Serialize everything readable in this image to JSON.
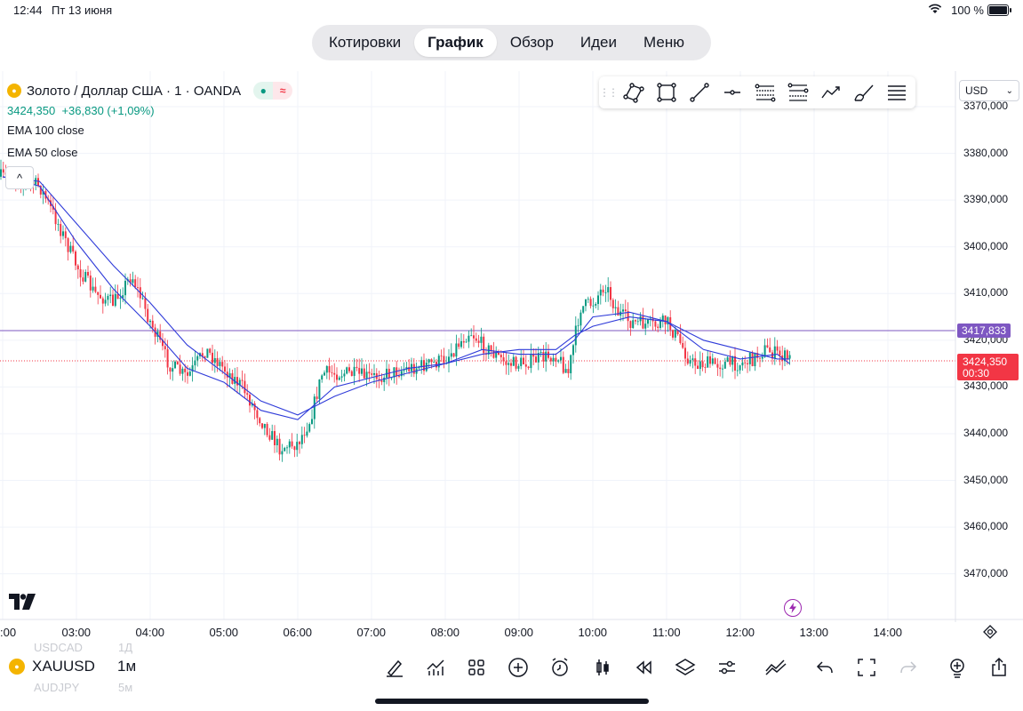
{
  "status_bar": {
    "time": "12:44",
    "date": "Пт 13 июня",
    "battery": "100 %"
  },
  "tabs": [
    {
      "label": "Котировки",
      "active": false
    },
    {
      "label": "График",
      "active": true
    },
    {
      "label": "Обзор",
      "active": false
    },
    {
      "label": "Идеи",
      "active": false
    },
    {
      "label": "Меню",
      "active": false
    }
  ],
  "legend": {
    "symbol_title": "Золото / Доллар США · 1 · OANDA",
    "last_price": "3424,350",
    "change": "+36,830 (+1,09%)",
    "indicators": [
      "EMA 100 close",
      "EMA 50 close"
    ],
    "collapse_glyph": "^"
  },
  "drawing_tools": [
    "pattern-icon",
    "rectangle-icon",
    "trend-line-icon",
    "horizontal-ray-icon",
    "fib-retracement-icon",
    "pitchfork-icon",
    "path-icon",
    "brush-icon",
    "more-tools-icon"
  ],
  "currency": {
    "selected": "USD"
  },
  "y_axis": {
    "ticks": [
      "3370,000",
      "3380,000",
      "3390,000",
      "3400,000",
      "3410,000",
      "3420,000",
      "3430,000",
      "3440,000",
      "3450,000",
      "3460,000",
      "3470,000"
    ]
  },
  "x_axis": {
    "ticks": [
      ":00",
      "03:00",
      "04:00",
      "05:00",
      "06:00",
      "07:00",
      "08:00",
      "09:00",
      "10:00",
      "11:00",
      "12:00",
      "13:00",
      "14:00"
    ]
  },
  "price_badges": {
    "alert_line": "3417,833",
    "current_price": "3424,350",
    "countdown": "00:30"
  },
  "colors": {
    "up": "#089981",
    "down": "#f23645",
    "ema": "#2f3bd9",
    "alert": "#7e57c2",
    "grid": "#f0f3fa"
  },
  "bottom_bar": {
    "symbol": "XAUUSD",
    "interval": "1м",
    "faded_symbol_above": "USDCAD",
    "faded_interval_above": "1Д",
    "faded_symbol_below": "AUDJPY",
    "faded_interval_below": "5м",
    "tools": [
      "draw-icon",
      "indicators-icon",
      "templates-icon",
      "add-icon",
      "alert-icon",
      "chart-type-icon",
      "replay-icon",
      "layers-icon",
      "settings-icon",
      "compare-icon",
      "undo-icon",
      "fullscreen-icon",
      "redo-icon",
      "ideas-icon",
      "share-icon"
    ]
  },
  "chart_data": {
    "type": "candlestick",
    "symbol": "XAUUSD",
    "y_scale": "inverted",
    "ylim": [
      3366,
      3480
    ],
    "x_range": [
      "02:00",
      "14:00"
    ],
    "grid": true,
    "indicators": [
      "EMA 100 close",
      "EMA 50 close"
    ],
    "alert_level": 3417.833,
    "last_price": 3424.35,
    "close_path": [
      [
        "02:00",
        3385
      ],
      [
        "02:20",
        3386
      ],
      [
        "02:30",
        3387
      ],
      [
        "02:45",
        3395
      ],
      [
        "03:00",
        3404
      ],
      [
        "03:15",
        3410
      ],
      [
        "03:30",
        3412
      ],
      [
        "03:45",
        3406
      ],
      [
        "04:00",
        3416
      ],
      [
        "04:15",
        3425
      ],
      [
        "04:30",
        3428
      ],
      [
        "04:45",
        3422
      ],
      [
        "05:00",
        3426
      ],
      [
        "05:15",
        3430
      ],
      [
        "05:30",
        3437
      ],
      [
        "05:45",
        3443
      ],
      [
        "06:00",
        3442
      ],
      [
        "06:10",
        3437
      ],
      [
        "06:20",
        3427
      ],
      [
        "06:40",
        3427
      ],
      [
        "07:00",
        3428
      ],
      [
        "07:30",
        3426
      ],
      [
        "07:50",
        3425
      ],
      [
        "08:00",
        3424
      ],
      [
        "08:10",
        3421
      ],
      [
        "08:20",
        3418
      ],
      [
        "08:30",
        3421
      ],
      [
        "08:40",
        3423
      ],
      [
        "08:50",
        3425
      ],
      [
        "09:00",
        3425
      ],
      [
        "09:15",
        3424
      ],
      [
        "09:30",
        3423
      ],
      [
        "09:40",
        3427
      ],
      [
        "09:50",
        3413
      ],
      [
        "10:00",
        3412
      ],
      [
        "10:10",
        3408
      ],
      [
        "10:20",
        3414
      ],
      [
        "10:30",
        3416
      ],
      [
        "10:50",
        3417
      ],
      [
        "11:00",
        3416
      ],
      [
        "11:10",
        3420
      ],
      [
        "11:20",
        3425
      ],
      [
        "11:35",
        3425
      ],
      [
        "11:45",
        3425
      ],
      [
        "12:00",
        3425
      ],
      [
        "12:10",
        3424
      ],
      [
        "12:20",
        3422
      ],
      [
        "12:30",
        3423
      ],
      [
        "12:40",
        3424
      ]
    ],
    "ema100": [
      [
        "02:00",
        3385
      ],
      [
        "02:30",
        3386
      ],
      [
        "03:00",
        3395
      ],
      [
        "03:30",
        3404
      ],
      [
        "04:00",
        3412
      ],
      [
        "04:30",
        3421
      ],
      [
        "05:00",
        3427
      ],
      [
        "05:30",
        3433
      ],
      [
        "06:00",
        3436
      ],
      [
        "06:30",
        3432
      ],
      [
        "07:00",
        3429
      ],
      [
        "07:30",
        3427
      ],
      [
        "08:00",
        3425
      ],
      [
        "08:30",
        3423
      ],
      [
        "09:00",
        3422
      ],
      [
        "09:30",
        3422
      ],
      [
        "09:45",
        3419
      ],
      [
        "10:00",
        3417
      ],
      [
        "10:30",
        3415
      ],
      [
        "11:00",
        3416
      ],
      [
        "11:30",
        3420
      ],
      [
        "12:00",
        3422
      ],
      [
        "12:30",
        3424
      ],
      [
        "12:40",
        3424
      ]
    ],
    "ema50": [
      [
        "02:00",
        3385
      ],
      [
        "02:30",
        3387
      ],
      [
        "03:00",
        3399
      ],
      [
        "03:30",
        3409
      ],
      [
        "04:00",
        3417
      ],
      [
        "04:30",
        3426
      ],
      [
        "05:00",
        3429
      ],
      [
        "05:30",
        3435
      ],
      [
        "06:00",
        3437
      ],
      [
        "06:30",
        3430
      ],
      [
        "07:00",
        3428
      ],
      [
        "07:30",
        3426
      ],
      [
        "08:00",
        3425
      ],
      [
        "08:30",
        3422
      ],
      [
        "09:00",
        3423
      ],
      [
        "09:30",
        3423
      ],
      [
        "09:45",
        3420
      ],
      [
        "10:00",
        3415
      ],
      [
        "10:30",
        3414
      ],
      [
        "11:00",
        3416
      ],
      [
        "11:30",
        3422
      ],
      [
        "12:00",
        3424
      ],
      [
        "12:30",
        3423
      ],
      [
        "12:40",
        3425
      ]
    ]
  }
}
